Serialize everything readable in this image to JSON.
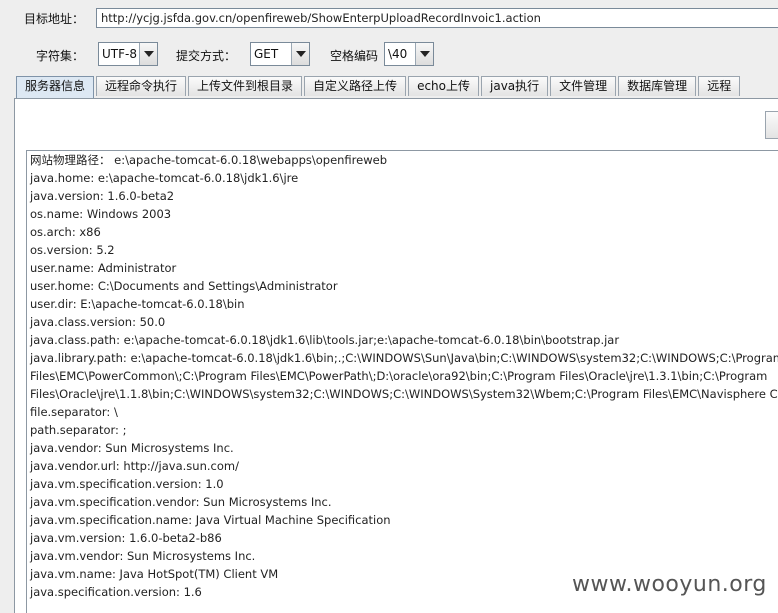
{
  "url_row": {
    "label": "目标地址：",
    "value": "http://ycjg.jsfda.gov.cn/openfireweb/ShowEnterpUploadRecordInvoic1.action"
  },
  "options": {
    "charset_label": "字符集：",
    "charset_value": "UTF-8",
    "method_label": "提交方式：",
    "method_value": "GET",
    "space_label": "空格编码",
    "space_value": "\\40"
  },
  "tabs": [
    {
      "label": "服务器信息",
      "active": true
    },
    {
      "label": "远程命令执行",
      "active": false
    },
    {
      "label": "上传文件到根目录",
      "active": false
    },
    {
      "label": "自定义路径上传",
      "active": false
    },
    {
      "label": "echo上传",
      "active": false
    },
    {
      "label": "java执行",
      "active": false
    },
    {
      "label": "文件管理",
      "active": false
    },
    {
      "label": "数据库管理",
      "active": false
    },
    {
      "label": "远程",
      "active": false
    }
  ],
  "info_lines": [
    "网站物理路径： e:\\apache-tomcat-6.0.18\\webapps\\openfireweb",
    "java.home: e:\\apache-tomcat-6.0.18\\jdk1.6\\jre",
    "java.version: 1.6.0-beta2",
    "os.name: Windows 2003",
    "os.arch: x86",
    "os.version: 5.2",
    "user.name: Administrator",
    "user.home: C:\\Documents and Settings\\Administrator",
    "user.dir: E:\\apache-tomcat-6.0.18\\bin",
    "java.class.version: 50.0",
    "java.class.path: e:\\apache-tomcat-6.0.18\\jdk1.6\\lib\\tools.jar;e:\\apache-tomcat-6.0.18\\bin\\bootstrap.jar",
    "java.library.path: e:\\apache-tomcat-6.0.18\\jdk1.6\\bin;.;C:\\WINDOWS\\Sun\\Java\\bin;C:\\WINDOWS\\system32;C:\\WINDOWS;C:\\Program",
    "Files\\EMC\\PowerCommon\\;C:\\Program Files\\EMC\\PowerPath\\;D:\\oracle\\ora92\\bin;C:\\Program Files\\Oracle\\jre\\1.3.1\\bin;C:\\Program",
    "Files\\Oracle\\jre\\1.1.8\\bin;C:\\WINDOWS\\system32;C:\\WINDOWS;C:\\WINDOWS\\System32\\Wbem;C:\\Program Files\\EMC\\Navisphere CLI",
    "file.separator: \\",
    "path.separator: ;",
    "java.vendor: Sun Microsystems Inc.",
    "java.vendor.url: http://java.sun.com/",
    "java.vm.specification.version: 1.0",
    "java.vm.specification.vendor: Sun Microsystems Inc.",
    "java.vm.specification.name: Java Virtual Machine Specification",
    "java.vm.version: 1.6.0-beta2-b86",
    "java.vm.vendor: Sun Microsystems Inc.",
    "java.vm.name: Java HotSpot(TM) Client VM",
    "java.specification.version: 1.6"
  ],
  "watermark": "www.wooyun.org"
}
